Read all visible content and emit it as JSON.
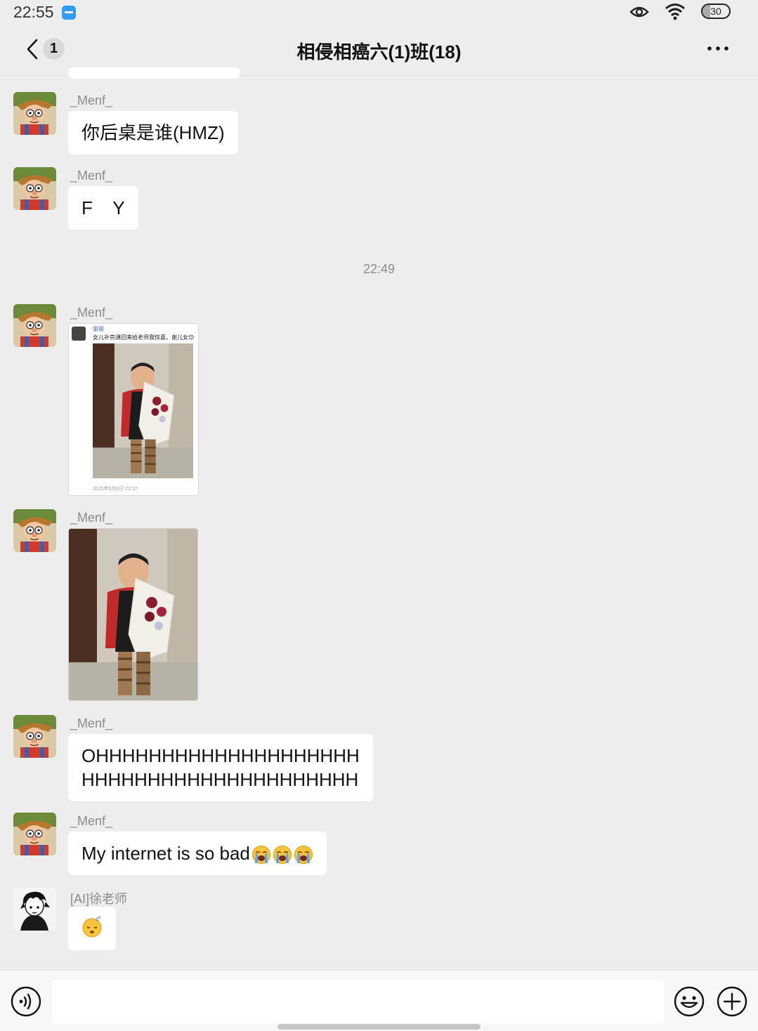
{
  "status_bar": {
    "time": "22:55",
    "battery_text": "30",
    "battery_level": 0.3
  },
  "header": {
    "title": "相侵相癌六(1)班(18)",
    "unread_count": "1"
  },
  "messages": [
    {
      "sender": "_Menf_",
      "type": "text",
      "text": "你后桌是谁(HMZ)"
    },
    {
      "sender": "_Menf_",
      "type": "text",
      "text": "F    Y"
    },
    {
      "type": "time",
      "text": "22:49"
    },
    {
      "sender": "_Menf_",
      "type": "screenshot_card",
      "card_name": "丽丽",
      "card_text": "女儿补完课回来给老师我惊喜，谢儿女😊",
      "card_date": "2025年3月8日 22:37"
    },
    {
      "sender": "_Menf_",
      "type": "image"
    },
    {
      "sender": "_Menf_",
      "type": "text",
      "line1": "OHHHHHHHHHHHHHHHHHHHH",
      "line2": "HHHHHHHHHHHHHHHHHHHHH"
    },
    {
      "sender": "_Menf_",
      "type": "text",
      "text": "My internet is so bad"
    },
    {
      "sender": "[AI]徐老师",
      "type": "emoji"
    }
  ],
  "icons": {
    "back": "back-chevron-icon",
    "more": "more-dots-icon",
    "voice": "voice-icon",
    "emoji": "emoji-icon",
    "plus": "plus-icon",
    "loudly_crying": "loudly-crying-emoji",
    "sleeping": "sleeping-emoji"
  },
  "input": {
    "placeholder": ""
  }
}
